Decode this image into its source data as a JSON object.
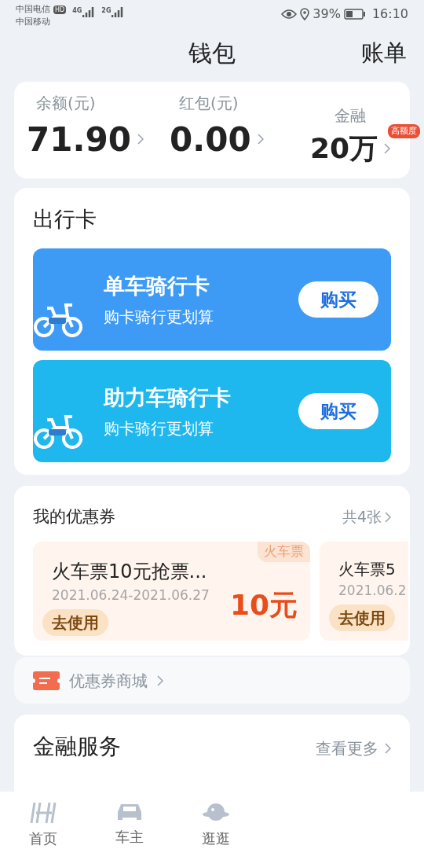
{
  "status_bar": {
    "carrier_1": "中国电信",
    "hd": "HD",
    "network_1": "4G",
    "carrier_2": "中国移动",
    "network_2": "2G",
    "battery": "39%",
    "time": "16:10"
  },
  "header": {
    "title": "钱包",
    "action": "账单"
  },
  "balances": [
    {
      "label": "余额(元)",
      "value": "71.90"
    },
    {
      "label": "红包(元)",
      "value": "0.00"
    },
    {
      "label": "金融",
      "value": "20万",
      "badge": "高额度"
    }
  ],
  "travel_cards": {
    "title": "出行卡",
    "items": [
      {
        "name": "单车骑行卡",
        "subtitle": "购卡骑行更划算",
        "button": "购买",
        "color": "#3d9bf5"
      },
      {
        "name": "助力车骑行卡",
        "subtitle": "购卡骑行更划算",
        "button": "购买",
        "color": "#1fb8ee"
      }
    ]
  },
  "coupons": {
    "title": "我的优惠券",
    "count": "共4张",
    "items": [
      {
        "title": "火车票10元抢票...",
        "dates": "2021.06.24-2021.06.27",
        "tag": "火车票",
        "amount": "10元",
        "button": "去使用"
      },
      {
        "title": "火车票5",
        "dates": "2021.06.2",
        "button": "去使用"
      }
    ],
    "mall": "优惠券商城"
  },
  "finance": {
    "title": "金融服务",
    "more": "查看更多"
  },
  "tab_bar": [
    {
      "label": "首页",
      "kind": "home"
    },
    {
      "label": "车主",
      "kind": "car"
    },
    {
      "label": "逛逛",
      "kind": "planet"
    }
  ]
}
